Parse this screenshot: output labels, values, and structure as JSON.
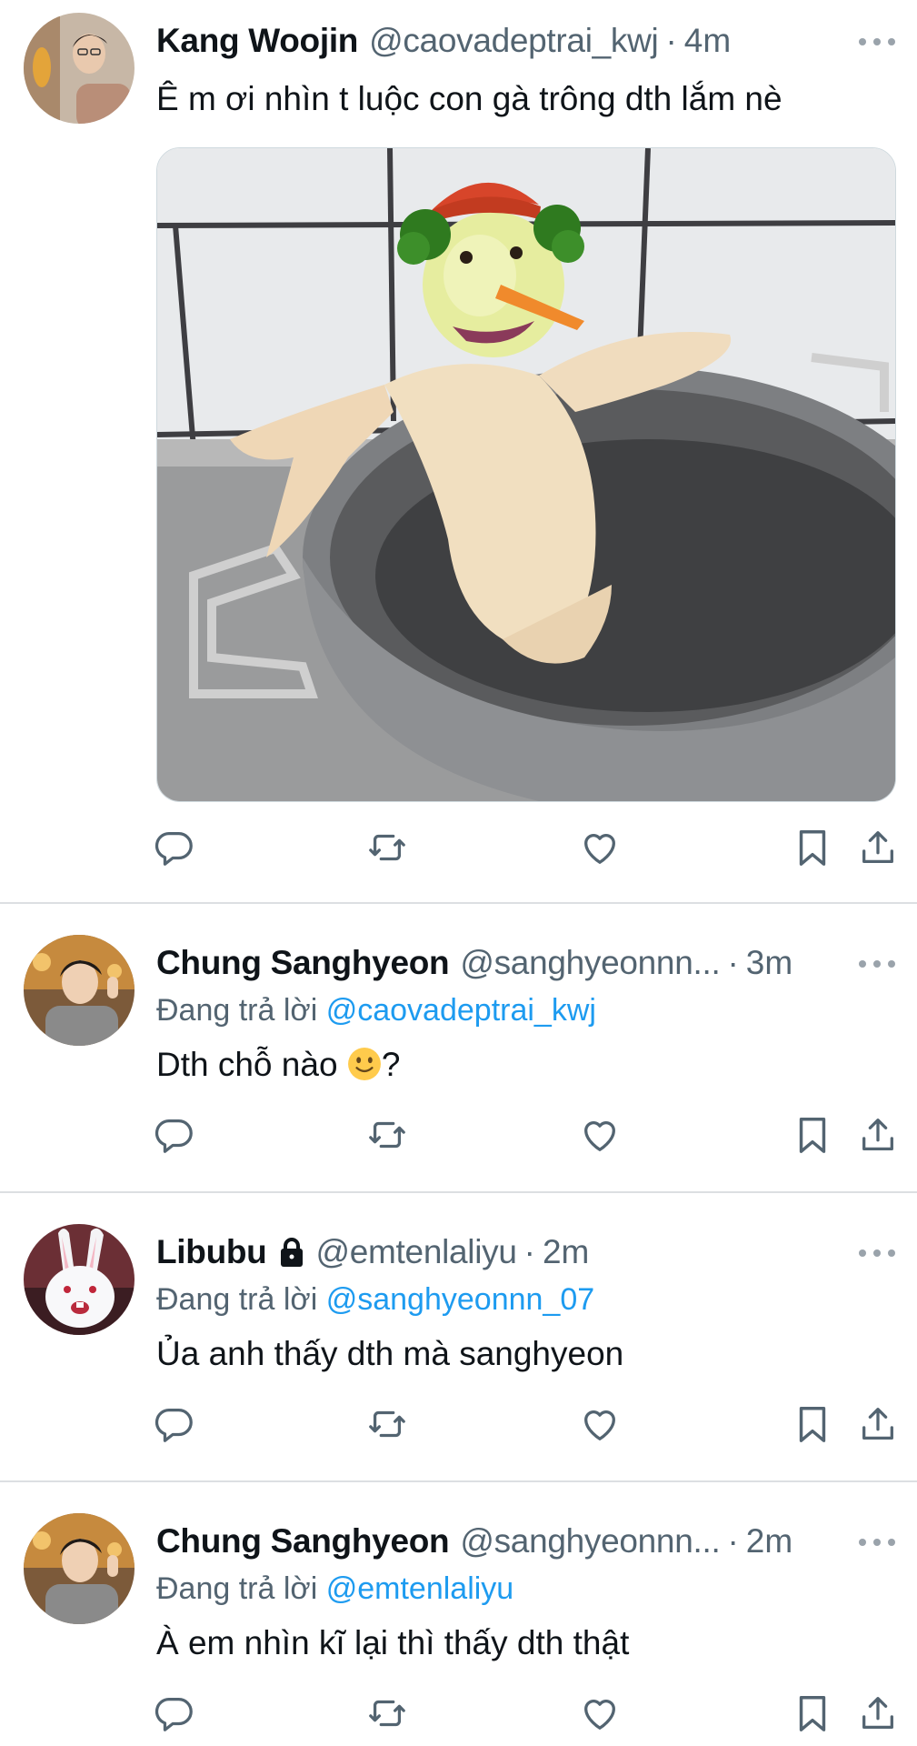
{
  "tweets": [
    {
      "name": "Kang Woojin",
      "handle": "@caovadeptrai_kwj",
      "time": "4m",
      "text": "Ê m ơi nhìn t luộc con gà trông dth lắm nè"
    },
    {
      "name": "Chung Sanghyeon",
      "handle": "@sanghyeonnn...",
      "time": "3m",
      "reply_prefix": "Đang trả lời",
      "reply_mention": "@caovadeptrai_kwj",
      "text_before": "Dth chỗ nào",
      "text_after": "?"
    },
    {
      "name": "Libubu",
      "handle": "@emtenlaliyu",
      "time": "2m",
      "reply_prefix": "Đang trả lời",
      "reply_mention": "@sanghyeonnn_07",
      "text": "Ủa anh thấy dth mà sanghyeon"
    },
    {
      "name": "Chung Sanghyeon",
      "handle": "@sanghyeonnn...",
      "time": "2m",
      "reply_prefix": "Đang trả lời",
      "reply_mention": "@emtenlaliyu",
      "text": "À em nhìn kĩ lại thì thấy dth thật"
    }
  ],
  "dot_separator": "·",
  "icons": {
    "reply": "comment-bubble-icon",
    "retweet": "retweet-icon",
    "like": "heart-icon",
    "bookmark": "bookmark-icon",
    "share": "share-upload-icon",
    "more": "more-dots-icon",
    "protected": "lock-icon",
    "emoji": "slightly-smiling-face-emoji"
  },
  "colors": {
    "text": "#0f1419",
    "secondary": "#536471",
    "link": "#1d9bf0",
    "divider": "#dcdfe2"
  }
}
